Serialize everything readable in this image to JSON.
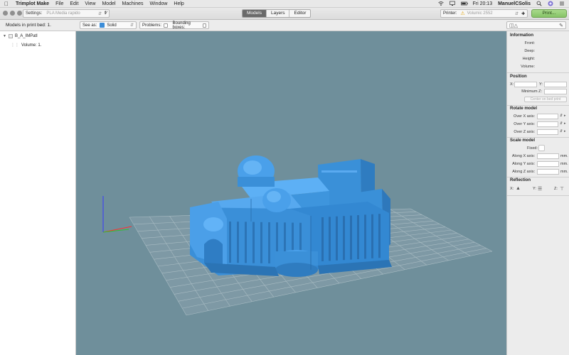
{
  "menubar": {
    "items": [
      "Trimplot Make",
      "File",
      "Edit",
      "View",
      "Model",
      "Machines",
      "Window",
      "Help"
    ],
    "clock": "Fri 20:13",
    "user": "ManuelCSolis"
  },
  "toolbar": {
    "settings_label": "Settings:",
    "settings_value": "PLA Media rapido",
    "tabs": [
      "Models",
      "Layers",
      "Editor"
    ],
    "active_tab": "Models",
    "printer_label": "Printer:",
    "printer_value": "Volumic 2552",
    "print_button": "Print..."
  },
  "subbar": {
    "models_title": "Models in print bed: 1.",
    "see_as_label": "See as:",
    "see_as_value": "Solid",
    "problems_label": "Problems:",
    "bounding_label": "Bounding boxes:"
  },
  "tree": {
    "root": "B_A_IMPatl",
    "child": "Volume: 1."
  },
  "info": {
    "title": "Information",
    "front": "Front:",
    "deep": "Deep:",
    "height": "Height:",
    "volume": "Volume:"
  },
  "position": {
    "title": "Position",
    "x": "X:",
    "y": "Y:",
    "min_z": "Minimum Z:",
    "center_button": "Center on bed print"
  },
  "rotate": {
    "title": "Rotate model",
    "over_x": "Over X axis:",
    "over_y": "Over Y axis:",
    "over_z": "Over Z axis:"
  },
  "scale": {
    "title": "Scale model",
    "fixed": "Fixed:",
    "along_x": "Along X axis:",
    "along_y": "Along Y axis:",
    "along_z": "Along Z axis:",
    "unit": "mm."
  },
  "reflection": {
    "title": "Reflection",
    "x": "X:",
    "y": "Y:",
    "z": "Z:"
  },
  "colors": {
    "viewport_bg": "#6f8f9b",
    "model": "#3d97e0",
    "grid": "#9aaeb6",
    "print_button": "#8fcc6f"
  }
}
